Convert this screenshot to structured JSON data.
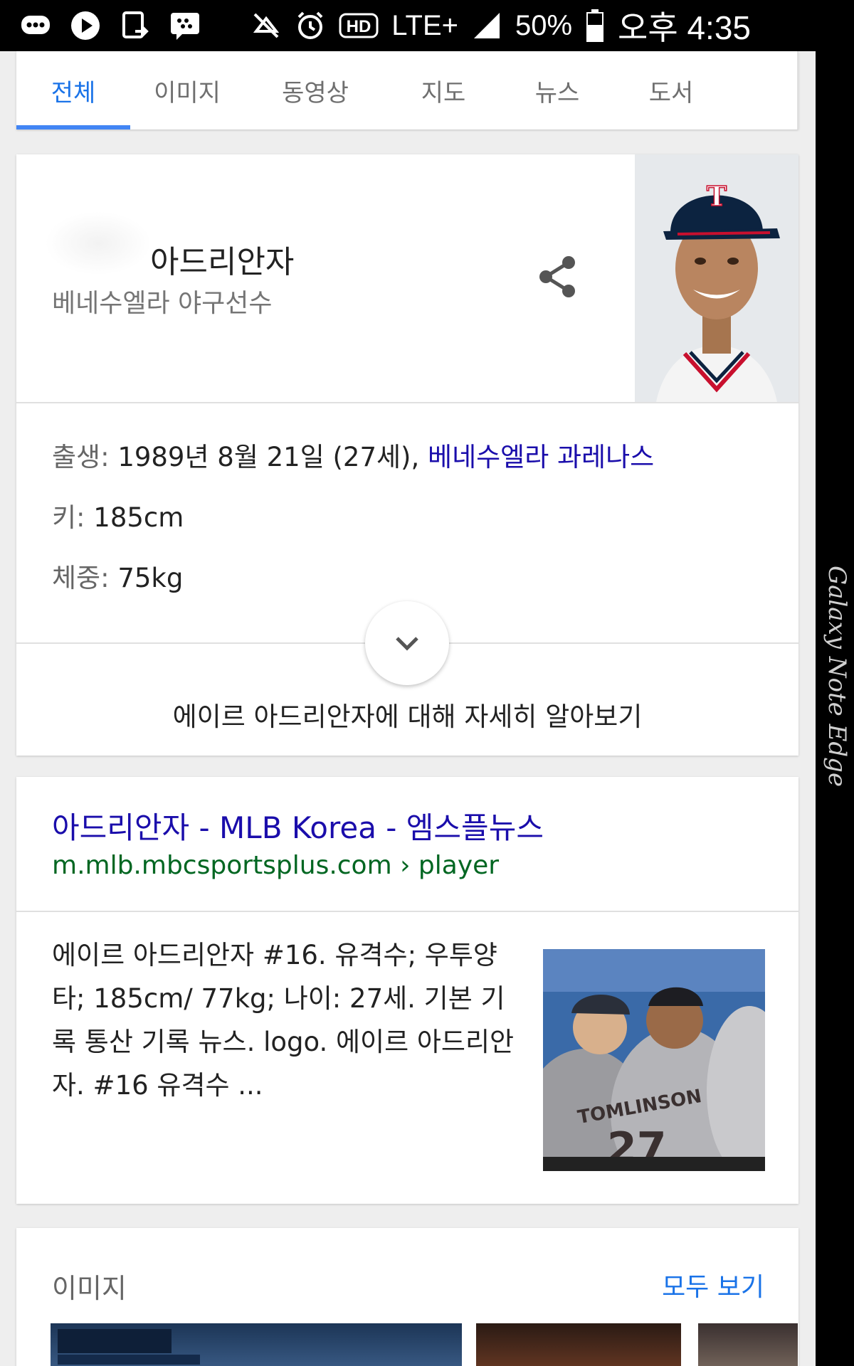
{
  "status_bar": {
    "network": "LTE+",
    "battery": "50%",
    "time": "오후 4:35"
  },
  "tabs": [
    {
      "label": "전체",
      "active": true
    },
    {
      "label": "이미지",
      "active": false
    },
    {
      "label": "동영상",
      "active": false
    },
    {
      "label": "지도",
      "active": false
    },
    {
      "label": "뉴스",
      "active": false
    },
    {
      "label": "도서",
      "active": false
    }
  ],
  "knowledge_panel": {
    "name": "아드리안자",
    "subtitle": "베네수엘라 야구선수",
    "facts": {
      "born_label": "출생:",
      "born_value": "1989년 8월 21일 (27세),",
      "born_place": "베네수엘라 과레나스",
      "height_label": "키:",
      "height_value": "185cm",
      "weight_label": "체중:",
      "weight_value": "75kg"
    },
    "more_label": "에이르 아드리안자에 대해 자세히 알아보기"
  },
  "result": {
    "title": "아드리안자 - MLB Korea - 엠스플뉴스",
    "url": "m.mlb.mbcsportsplus.com › player",
    "snippet": "에이르 아드리안자 #16. 유격수; 우투양타; 185cm/ 77kg; 나이: 27세. 기본 기록 통산 기록 뉴스. logo. 에이르 아드리안자. #16 유격수 ..."
  },
  "images_section": {
    "heading": "이미지",
    "see_all": "모두 보기"
  },
  "device_edge_label": "Galaxy Note Edge",
  "colors": {
    "accent": "#4285f4",
    "link": "#1a0dab",
    "url": "#006621"
  }
}
